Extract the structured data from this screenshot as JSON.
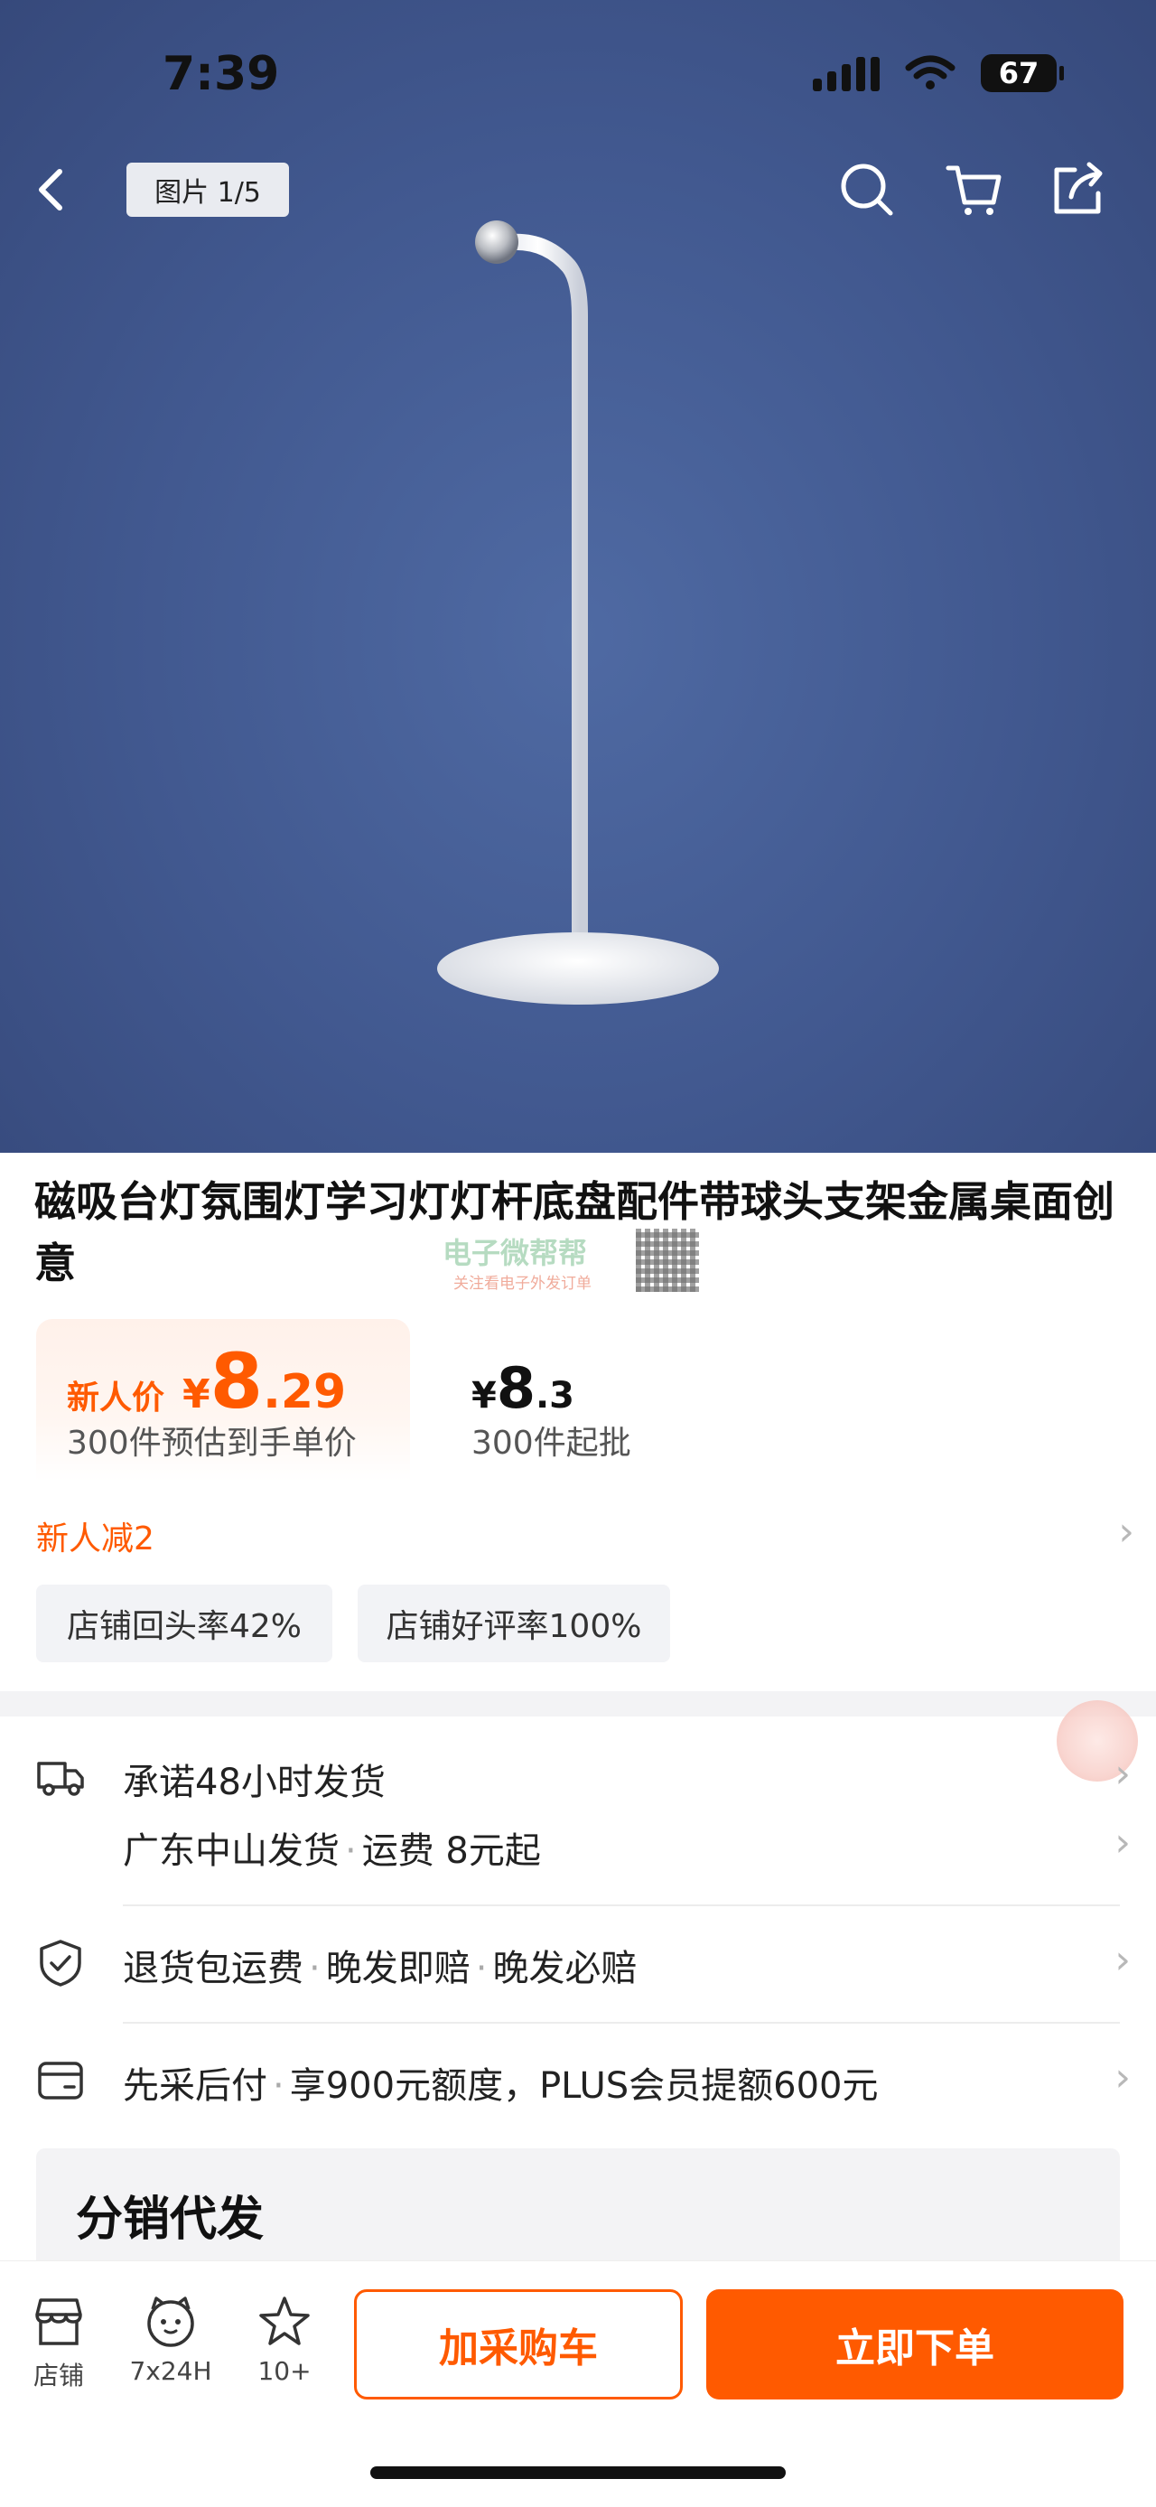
{
  "status_bar": {
    "time": "7:39",
    "battery": "67"
  },
  "header": {
    "image_counter": "图片 1/5"
  },
  "product": {
    "title": "磁吸台灯氛围灯学习灯灯杆底盘配件带球头支架金属桌面创意"
  },
  "watermark": {
    "text": "电子微帮帮",
    "sub": "关注看电子外发订单"
  },
  "pricing": {
    "newcomer_label": "新人价",
    "newcomer_currency": "¥",
    "newcomer_int": "8",
    "newcomer_dec": ".29",
    "newcomer_note": "300件预估到手单价",
    "standard_currency": "¥",
    "standard_int": "8",
    "standard_dec": ".3",
    "standard_note": "300件起批"
  },
  "promo": {
    "text": "新人减2"
  },
  "badges": [
    "店铺回头率42%",
    "店铺好评率100%"
  ],
  "services": {
    "shipping_line1": "承诺48小时发货",
    "shipping_line2_a": "广东中山发货",
    "shipping_line2_b": "运费 8元起",
    "returns_a": "退货包运费",
    "returns_b": "晚发即赔",
    "returns_c": "晚发必赔",
    "credit_a": "先采后付",
    "credit_b": "享900元额度，PLUS会员提额600元"
  },
  "resale": {
    "title": "分销代发"
  },
  "bottom_bar": {
    "tabs": [
      {
        "label": "店铺",
        "icon": "store-icon"
      },
      {
        "label": "7x24H",
        "icon": "customer-service-icon"
      },
      {
        "label": "10+",
        "icon": "star-icon"
      }
    ],
    "add_to_cart": "加采购车",
    "buy_now": "立即下单"
  },
  "colors": {
    "accent": "#ff5a00",
    "hero_bg": "#41588f"
  }
}
